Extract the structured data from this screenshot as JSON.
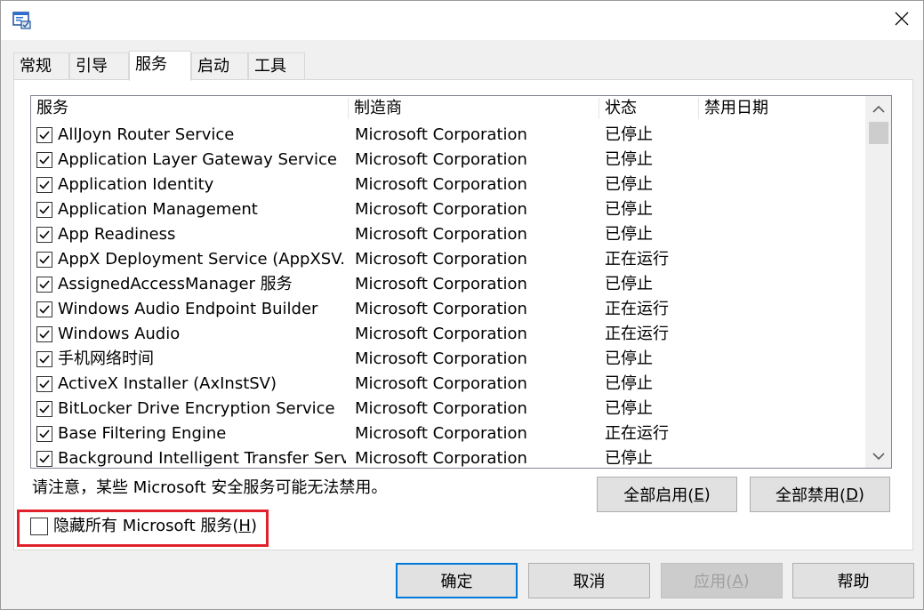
{
  "tabs": [
    "常规",
    "引导",
    "服务",
    "启动",
    "工具"
  ],
  "active_tab_index": 2,
  "columns": {
    "service": "服务",
    "manufacturer": "制造商",
    "status": "状态",
    "disabled_date": "禁用日期"
  },
  "services": [
    {
      "name": "AllJoyn Router Service",
      "manufacturer": "Microsoft Corporation",
      "status": "已停止",
      "checked": true
    },
    {
      "name": "Application Layer Gateway Service",
      "manufacturer": "Microsoft Corporation",
      "status": "已停止",
      "checked": true
    },
    {
      "name": "Application Identity",
      "manufacturer": "Microsoft Corporation",
      "status": "已停止",
      "checked": true
    },
    {
      "name": "Application Management",
      "manufacturer": "Microsoft Corporation",
      "status": "已停止",
      "checked": true
    },
    {
      "name": "App Readiness",
      "manufacturer": "Microsoft Corporation",
      "status": "已停止",
      "checked": true
    },
    {
      "name": "AppX Deployment Service (AppXSV...",
      "manufacturer": "Microsoft Corporation",
      "status": "正在运行",
      "checked": true
    },
    {
      "name": "AssignedAccessManager 服务",
      "manufacturer": "Microsoft Corporation",
      "status": "已停止",
      "checked": true
    },
    {
      "name": "Windows Audio Endpoint Builder",
      "manufacturer": "Microsoft Corporation",
      "status": "正在运行",
      "checked": true
    },
    {
      "name": "Windows Audio",
      "manufacturer": "Microsoft Corporation",
      "status": "正在运行",
      "checked": true
    },
    {
      "name": "手机网络时间",
      "manufacturer": "Microsoft Corporation",
      "status": "已停止",
      "checked": true
    },
    {
      "name": "ActiveX Installer (AxInstSV)",
      "manufacturer": "Microsoft Corporation",
      "status": "已停止",
      "checked": true
    },
    {
      "name": "BitLocker Drive Encryption Service",
      "manufacturer": "Microsoft Corporation",
      "status": "已停止",
      "checked": true
    },
    {
      "name": "Base Filtering Engine",
      "manufacturer": "Microsoft Corporation",
      "status": "正在运行",
      "checked": true
    },
    {
      "name": "Background Intelligent Transfer Serv...",
      "manufacturer": "Microsoft Corporation",
      "status": "已停止",
      "checked": true
    }
  ],
  "note": "请注意，某些 Microsoft 安全服务可能无法禁用。",
  "enable_all": {
    "text": "全部启用(",
    "key": "E",
    "end": ")"
  },
  "disable_all": {
    "text": "全部禁用(",
    "key": "D",
    "end": ")"
  },
  "hide_ms": {
    "text": "隐藏所有 Microsoft 服务(",
    "key": "H",
    "end": ")",
    "checked": false
  },
  "buttons": {
    "ok": "确定",
    "cancel": "取消",
    "apply": {
      "text": "应用(",
      "key": "A",
      "end": ")"
    },
    "help": "帮助"
  },
  "colors": {
    "highlight_border": "#e0212b",
    "default_button_border": "#0078d7"
  }
}
